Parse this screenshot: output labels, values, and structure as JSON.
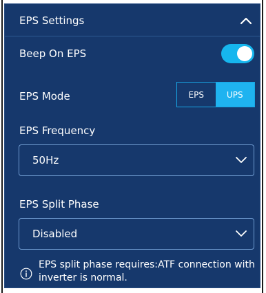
{
  "panel": {
    "title": "EPS Settings",
    "collapse_icon": "chevron-up-icon"
  },
  "beep": {
    "label": "Beep On EPS",
    "enabled": true
  },
  "mode": {
    "label": "EPS Mode",
    "options": [
      "EPS",
      "UPS"
    ],
    "selected": "UPS"
  },
  "frequency": {
    "label": "EPS Frequency",
    "value": "50Hz"
  },
  "split_phase": {
    "label": "EPS Split Phase",
    "value": "Disabled"
  },
  "note": {
    "icon": "info-icon",
    "text": "EPS split phase requires:ATF connection with inverter is normal."
  },
  "colors": {
    "panel_bg": "#16386c",
    "accent": "#1fb3f0"
  }
}
